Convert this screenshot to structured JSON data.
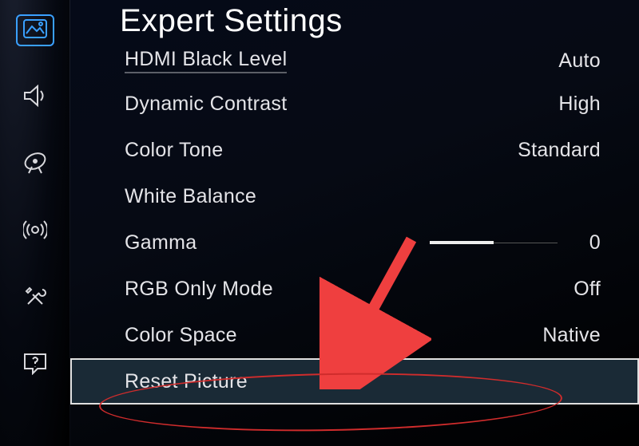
{
  "page": {
    "title": "Expert Settings"
  },
  "sidebar": {
    "items": [
      {
        "icon": "picture-icon",
        "active": true
      },
      {
        "icon": "sound-icon",
        "active": false
      },
      {
        "icon": "broadcast-icon",
        "active": false
      },
      {
        "icon": "antenna-icon",
        "active": false
      },
      {
        "icon": "tools-icon",
        "active": false
      },
      {
        "icon": "help-icon",
        "active": false
      }
    ]
  },
  "settings": [
    {
      "label": "HDMI Black Level",
      "value": "Auto",
      "kind": "text"
    },
    {
      "label": "Dynamic Contrast",
      "value": "High",
      "kind": "text"
    },
    {
      "label": "Color Tone",
      "value": "Standard",
      "kind": "text"
    },
    {
      "label": "White Balance",
      "value": "",
      "kind": "submenu"
    },
    {
      "label": "Gamma",
      "value": "0",
      "kind": "slider",
      "slider_ratio": 0.5
    },
    {
      "label": "RGB Only Mode",
      "value": "Off",
      "kind": "text"
    },
    {
      "label": "Color Space",
      "value": "Native",
      "kind": "text"
    },
    {
      "label": "Reset Picture",
      "value": "",
      "kind": "action",
      "selected": true
    }
  ],
  "annotation": {
    "arrow_color": "#ef3f3f",
    "ellipse_color": "#d02c2c"
  }
}
